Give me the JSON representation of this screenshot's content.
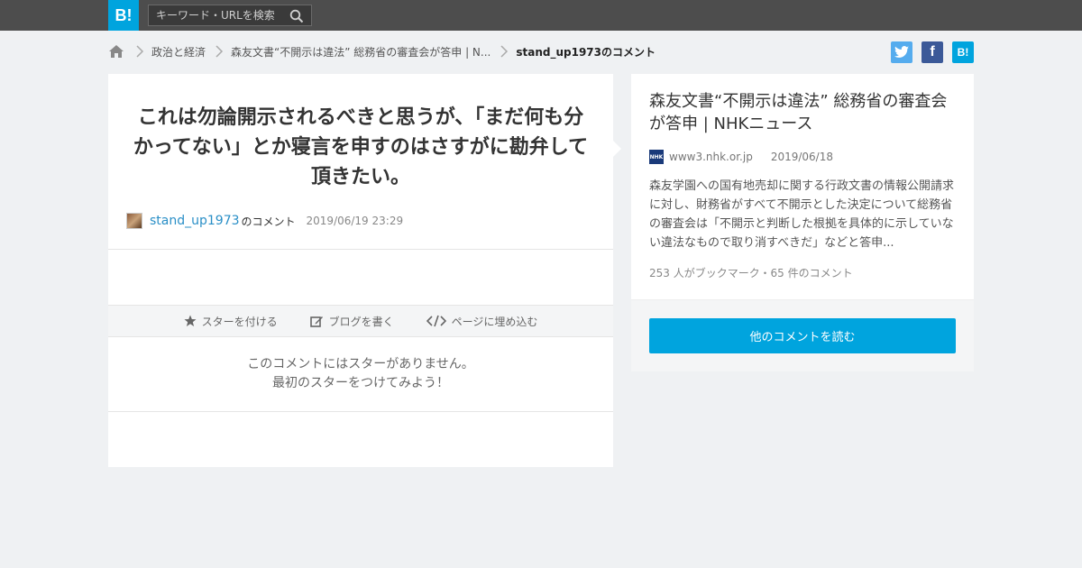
{
  "header": {
    "logo": "B!",
    "search_placeholder": "キーワード・URLを検索"
  },
  "breadcrumb": {
    "items": [
      {
        "label": "政治と経済"
      },
      {
        "label": "森友文書“不開示は違法” 総務省の審査会が答申 | N..."
      },
      {
        "label": "stand_up1973のコメント"
      }
    ]
  },
  "share": {
    "twitter_icon": "twitter-icon",
    "facebook": "f",
    "hatena": "B!"
  },
  "comment": {
    "text": "これは勿論開示されるべきと思うが、「まだ何も分かってない」とか寝言を申すのはさすがに勘弁して頂きたい。",
    "user": "stand_up1973",
    "suffix": "のコメント",
    "date": "2019/06/19 23:29"
  },
  "actions": {
    "star": "スターを付ける",
    "blog": "ブログを書く",
    "embed": "ページに埋め込む"
  },
  "stars": {
    "line1": "このコメントにはスターがありません。",
    "line2": "最初のスターをつけてみよう！"
  },
  "article": {
    "title": "森友文書“不開示は違法” 総務省の審査会が答申 | NHKニュース",
    "favicon_text": "NHK",
    "domain": "www3.nhk.or.jp",
    "date": "2019/06/18",
    "summary": "森友学園への国有地売却に関する行政文書の情報公開請求に対し、財務省がすべて不開示とした決定について総務省の審査会は「不開示と判断した根拠を具体的に示していない違法なもので取り消すべきだ」などと答申...",
    "stats": "253 人がブックマーク・65 件のコメント",
    "read_button": "他のコメントを読む"
  },
  "colors": {
    "brand": "#00a4de",
    "topbar": "#4d4d4d",
    "link": "#2a8fc7"
  }
}
